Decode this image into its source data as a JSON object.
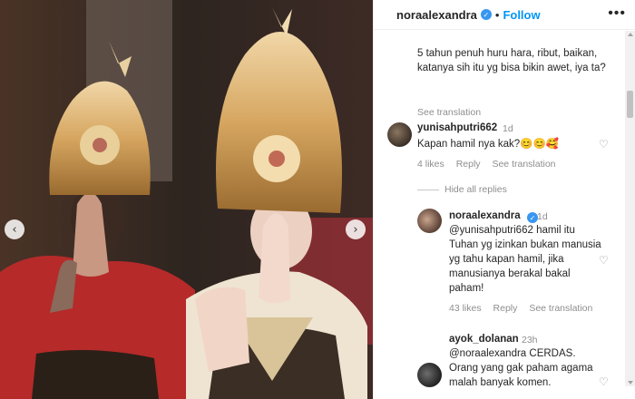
{
  "post": {
    "username": "noraalexandra",
    "separator": "•",
    "follow_label": "Follow",
    "more_icon": "more-horizontal-icon",
    "caption": "5 tahun penuh huru hara, ribut, baikan, katanya sih itu yg bisa bikin awet, iya ta?",
    "caption_see_translation": "See translation"
  },
  "comments": [
    {
      "username": "yunisahputri662",
      "time": "1d",
      "text": "Kapan hamil nya kak?😊😊🥰",
      "likes": "4 likes",
      "reply": "Reply",
      "see_translation": "See translation"
    }
  ],
  "hide_replies": "Hide all replies",
  "replies": [
    {
      "username": "noraalexandra",
      "time": "1d",
      "text": "@yunisahputri662 hamil itu Tuhan yg izinkan bukan manusia yg tahu kapan hamil, jika manusianya berakal bakal paham!",
      "likes": "43 likes",
      "reply": "Reply",
      "see_translation": "See translation"
    },
    {
      "username": "ayok_dolanan",
      "time": "23h",
      "text": "@noraalexandra CERDAS. Orang yang gak paham agama malah banyak komen."
    }
  ],
  "nav": {
    "prev": "‹",
    "next": "›"
  },
  "colors": {
    "link_blue": "#0095f6",
    "verified": "#3897f0",
    "muted": "#8e8e8e"
  }
}
